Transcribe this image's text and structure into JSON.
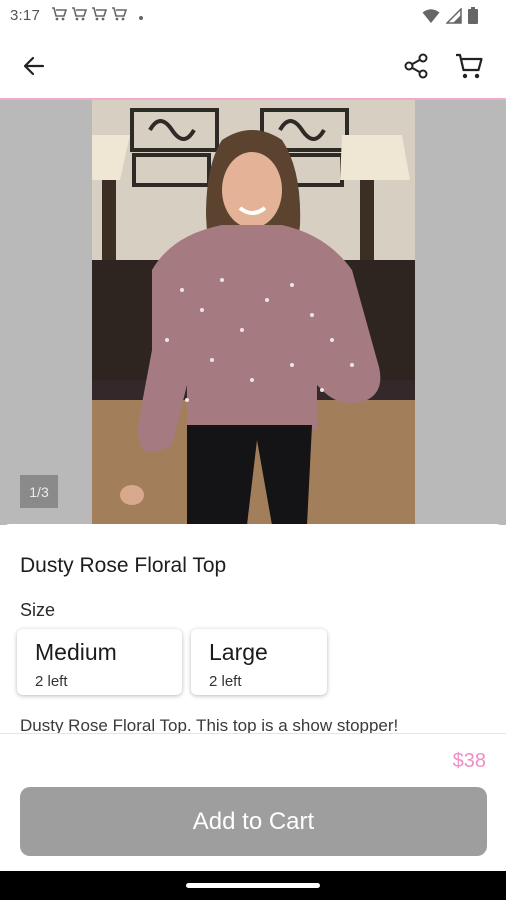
{
  "status_bar": {
    "time": "3:17",
    "notification_icons": [
      "cart-icon",
      "cart-icon",
      "cart-icon",
      "cart-icon"
    ],
    "system_icons": [
      "wifi-icon",
      "signal-icon",
      "battery-icon"
    ]
  },
  "app_bar": {
    "icons": [
      "arrow-back-icon",
      "share-icon",
      "cart-icon"
    ],
    "accent_color": "#f2a9cf"
  },
  "gallery": {
    "counter": "1/3"
  },
  "product": {
    "title": "Dusty Rose Floral Top",
    "size_label": "Size",
    "sizes": [
      {
        "name": "Medium",
        "stock": "2 left"
      },
      {
        "name": "Large",
        "stock": "2 left"
      }
    ],
    "description": "Dusty Rose Floral Top. This top is a show stopper!",
    "price": "$38",
    "price_color": "#f08fc6"
  },
  "footer": {
    "add_to_cart_label": "Add to Cart",
    "button_color": "#9e9e9e"
  }
}
